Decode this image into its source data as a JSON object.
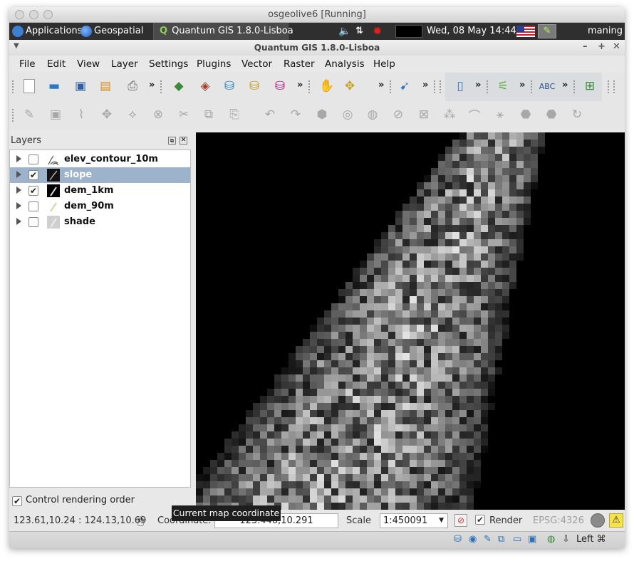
{
  "vm": {
    "title": "osgeolive6 [Running]"
  },
  "guest_panel": {
    "applications": "Applications",
    "geospatial": "Geospatial",
    "task": "Quantum GIS 1.8.0-Lisboa",
    "clock": "Wed, 08 May  14:44",
    "user": "maning"
  },
  "window": {
    "title": "Quantum GIS 1.8.0-Lisboa"
  },
  "menu": [
    "File",
    "Edit",
    "View",
    "Layer",
    "Settings",
    "Plugins",
    "Vector",
    "Raster",
    "Analysis",
    "Help"
  ],
  "toolbar": {
    "more": "»"
  },
  "layers_panel": {
    "title": "Layers",
    "layers": [
      {
        "name": "elev_contour_10m",
        "checked": false,
        "selected": false,
        "icon": "line-layer-icon"
      },
      {
        "name": "slope",
        "checked": true,
        "selected": true,
        "icon": "raster-layer-icon"
      },
      {
        "name": "dem_1km",
        "checked": true,
        "selected": false,
        "icon": "raster-layer-icon"
      },
      {
        "name": "dem_90m",
        "checked": false,
        "selected": false,
        "icon": "raster-layer-icon"
      },
      {
        "name": "shade",
        "checked": false,
        "selected": false,
        "icon": "raster-layer-icon"
      }
    ],
    "control_rendering_order": "Control rendering order"
  },
  "tooltip": "Current map coordinate",
  "statusbar": {
    "extent": "123.61,10.24 : 124.13,10.69",
    "coordinate_label": "Coordinate:",
    "coordinate_value": "123.446,10.291",
    "scale_label": "Scale",
    "scale_value": "1:450091",
    "render_label": "Render",
    "crs": "EPSG:4326"
  },
  "bottom_bar": {
    "host_key": "Left ⌘"
  },
  "colors": {
    "selection": "#9db3cc",
    "map_background": "#000000",
    "panel_dark": "#2f2f2f"
  }
}
